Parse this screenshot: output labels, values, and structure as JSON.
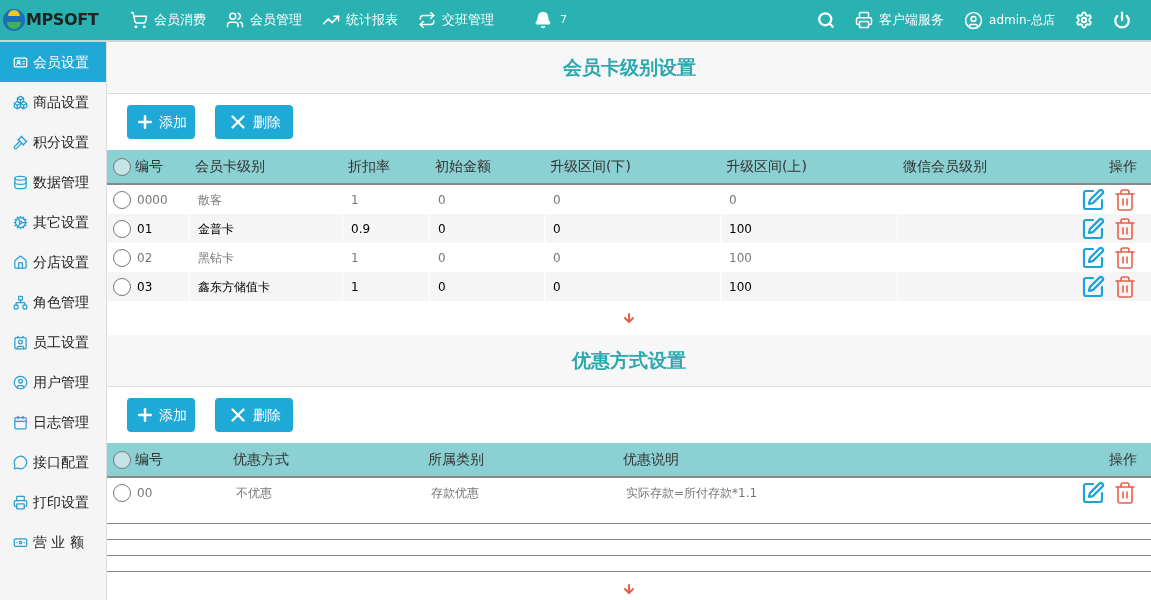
{
  "topbar": {
    "logo": "MPSOFT",
    "nav": [
      "会员消费",
      "会员管理",
      "统计报表",
      "交班管理"
    ],
    "notifications": "7",
    "client_service": "客户端服务",
    "user": "admin-总店"
  },
  "sidebar": {
    "items": [
      {
        "label": "会员设置",
        "selected": true
      },
      {
        "label": "商品设置",
        "selected": false
      },
      {
        "label": "积分设置",
        "selected": false
      },
      {
        "label": "数据管理",
        "selected": false
      },
      {
        "label": "其它设置",
        "selected": false
      },
      {
        "label": "分店设置",
        "selected": false
      },
      {
        "label": "角色管理",
        "selected": false
      },
      {
        "label": "员工设置",
        "selected": false
      },
      {
        "label": "用户管理",
        "selected": false
      },
      {
        "label": "日志管理",
        "selected": false
      },
      {
        "label": "接口配置",
        "selected": false
      },
      {
        "label": "打印设置",
        "selected": false
      },
      {
        "label": "营 业 额",
        "selected": false
      }
    ]
  },
  "sections": [
    {
      "title": "会员卡级别设置",
      "add": "添加",
      "delete": "删除",
      "all_selected": false,
      "columns": [
        "编号",
        "会员卡级别",
        "折扣率",
        "初始金额",
        "升级区间(下)",
        "升级区间(上)",
        "微信会员级别",
        "操作"
      ],
      "rows": [
        {
          "selected": false,
          "cells": [
            "0000",
            "散客",
            "1",
            "0",
            "0",
            "0",
            ""
          ]
        },
        {
          "selected": false,
          "cells": [
            "01",
            "金普卡",
            "0.9",
            "0",
            "0",
            "100",
            ""
          ]
        },
        {
          "selected": false,
          "cells": [
            "02",
            "黑钻卡",
            "1",
            "0",
            "0",
            "100",
            ""
          ]
        },
        {
          "selected": false,
          "cells": [
            "03",
            "鑫东方储值卡",
            "1",
            "0",
            "0",
            "100",
            ""
          ]
        }
      ]
    },
    {
      "title": "优惠方式设置",
      "add": "添加",
      "delete": "删除",
      "all_selected": false,
      "columns": [
        "编号",
        "优惠方式",
        "所属类别",
        "优惠说明",
        "操作"
      ],
      "rows": [
        {
          "selected": false,
          "cells": [
            "00",
            "不优惠",
            "存款优惠",
            "实际存款=所付存款*1.1"
          ]
        }
      ]
    }
  ]
}
